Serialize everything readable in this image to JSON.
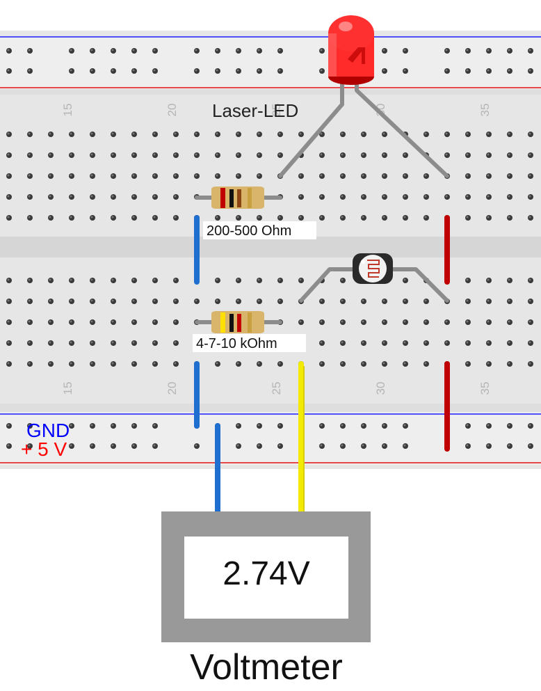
{
  "labels": {
    "led": "Laser-LED",
    "resistor_top": "200-500 Ohm",
    "resistor_bottom": "4-7-10 kOhm",
    "gnd": "GND",
    "plus5v": "+ 5 V",
    "voltmeter_title": "Voltmeter",
    "voltmeter_reading": "2.74V"
  },
  "column_numbers_top": [
    "15",
    "20",
    "25",
    "30",
    "35"
  ],
  "column_numbers_bottom": [
    "15",
    "20",
    "25",
    "30",
    "35"
  ],
  "colors": {
    "board": "#e6e6e6",
    "board_channel": "#d6d6d6",
    "hole": "#3a3a3a",
    "rail_blue_line": "#1a1aff",
    "rail_red_line": "#e01010",
    "wire_blue": "#1f6fd0",
    "wire_red": "#c00000",
    "wire_yellow": "#f2ea00",
    "lead_gray": "#8c8c8c",
    "led_red": "#ff2020",
    "resistor_body": "#d8b56a",
    "meter_frame": "#999999",
    "meter_screen": "#ffffff",
    "gnd_text": "#0000ff",
    "plus5v_text": "#ff0000"
  },
  "icons": {
    "led": "red-led-icon",
    "photoresistor": "photoresistor-icon",
    "resistor": "resistor-icon"
  }
}
